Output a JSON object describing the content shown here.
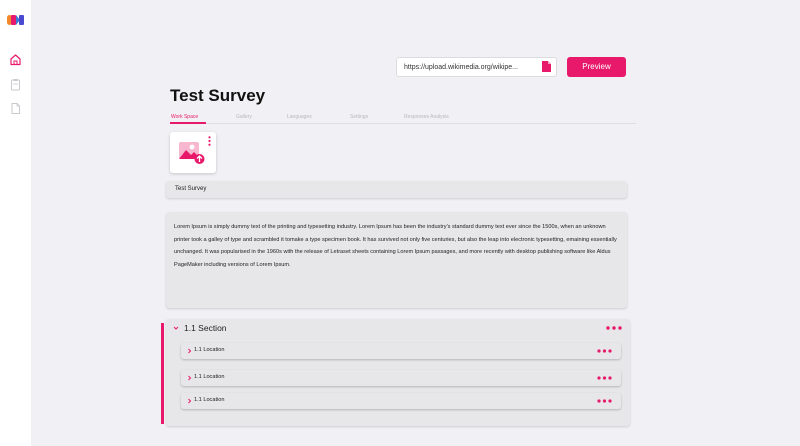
{
  "colors": {
    "accent": "#e8196b",
    "background": "#f1f0f4",
    "card": "#e7e6e9"
  },
  "sidebar": {
    "logo": "logo-icon",
    "items": [
      {
        "icon": "home-icon",
        "active": true
      },
      {
        "icon": "clipboard-icon",
        "active": false
      },
      {
        "icon": "document-icon",
        "active": false
      }
    ]
  },
  "toolbar": {
    "url_value": "https://upload.wikimedia.org/wikipe...",
    "preview_label": "Preview"
  },
  "page": {
    "title": "Test Survey"
  },
  "tabs": [
    {
      "label": "Work Space",
      "active": true
    },
    {
      "label": "Gallery",
      "active": false
    },
    {
      "label": "Languages",
      "active": false
    },
    {
      "label": "Settings",
      "active": false
    },
    {
      "label": "Responses Analysis",
      "active": false
    }
  ],
  "survey": {
    "name": "Test Survey",
    "description": "Lorem Ipsum is simply dummy text of the printing and typesetting industry. Lorem Ipsum has been the industry's standard dummy text ever since the 1500s, when an unknown printer took a galley of type and scrambled it tomake a type specimen book. It has survived not only five centuries, but also the leap into electronic typesetting, emaining essentially unchanged. It was popularised in the 1960s with the release of Letraset sheets containing Lorem Ipsum passages, and more recently with desktop publishing software like Aldus PageMaker including versions of Lorem Ipsum."
  },
  "section": {
    "title": "1.1 Section",
    "locations": [
      {
        "label": "1.1 Location"
      },
      {
        "label": "1.1 Location"
      },
      {
        "label": "1.1 Location"
      }
    ]
  }
}
